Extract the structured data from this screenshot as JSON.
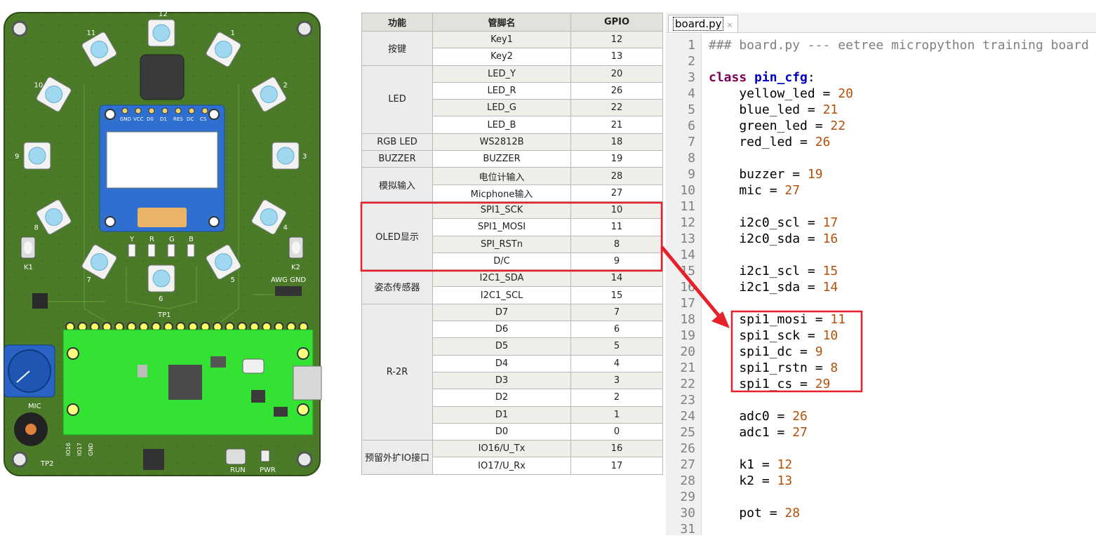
{
  "board": {
    "led_numbers": [
      "12",
      "1",
      "2",
      "3",
      "4",
      "5",
      "6",
      "7",
      "8",
      "9",
      "10",
      "11"
    ],
    "oled_pins": [
      "GND",
      "VCC",
      "D0",
      "D1",
      "RES",
      "DC",
      "CS"
    ],
    "led_row_labels": [
      "Y",
      "R",
      "G",
      "B"
    ],
    "k1_label": "K1",
    "k2_label": "K2",
    "awg_label": "AWG GND",
    "tp1_label": "TP1",
    "tp2_label": "TP2",
    "mic_label": "MIC",
    "run_label": "RUN",
    "pwr_label": "PWR",
    "pico_pins": [
      "IO16",
      "IO17",
      "GND"
    ],
    "colors": {
      "pcb": "#4a7a28",
      "pico": "#34e234",
      "oled_blue": "#2e6fd0",
      "led_cyan": "#9fd8f0"
    }
  },
  "table": {
    "headers": [
      "功能",
      "管脚名",
      "GPIO"
    ],
    "groups": [
      {
        "name": "按键",
        "rows": [
          [
            "Key1",
            "12"
          ],
          [
            "Key2",
            "13"
          ]
        ]
      },
      {
        "name": "LED",
        "rows": [
          [
            "LED_Y",
            "20"
          ],
          [
            "LED_R",
            "26"
          ],
          [
            "LED_G",
            "22"
          ],
          [
            "LED_B",
            "21"
          ]
        ]
      },
      {
        "name": "RGB LED",
        "rows": [
          [
            "WS2812B",
            "18"
          ]
        ]
      },
      {
        "name": "BUZZER",
        "rows": [
          [
            "BUZZER",
            "19"
          ]
        ]
      },
      {
        "name": "模拟输入",
        "rows": [
          [
            "电位计输入",
            "28"
          ],
          [
            "Micphone输入",
            "27"
          ]
        ]
      },
      {
        "name": "OLED显示",
        "rows": [
          [
            "SPI1_SCK",
            "10"
          ],
          [
            "SPI1_MOSI",
            "11"
          ],
          [
            "SPI_RSTn",
            "8"
          ],
          [
            "D/C",
            "9"
          ]
        ]
      },
      {
        "name": "姿态传感器",
        "rows": [
          [
            "I2C1_SDA",
            "14"
          ],
          [
            "I2C1_SCL",
            "15"
          ]
        ]
      },
      {
        "name": "R-2R",
        "rows": [
          [
            "D7",
            "7"
          ],
          [
            "D6",
            "6"
          ],
          [
            "D5",
            "5"
          ],
          [
            "D4",
            "4"
          ],
          [
            "D3",
            "3"
          ],
          [
            "D2",
            "2"
          ],
          [
            "D1",
            "1"
          ],
          [
            "D0",
            "0"
          ]
        ]
      },
      {
        "name": "预留外扩IO接口",
        "rows": [
          [
            "IO16/U_Tx",
            "16"
          ],
          [
            "IO17/U_Rx",
            "17"
          ]
        ]
      }
    ]
  },
  "editor": {
    "tab_label": "board.py",
    "tab_close": "×",
    "lines": [
      "### board.py --- eetree micropython training board",
      "",
      "class pin_cfg:",
      "    yellow_led = 20",
      "    blue_led = 21",
      "    green_led = 22",
      "    red_led = 26",
      "",
      "    buzzer = 19",
      "    mic = 27",
      "",
      "    i2c0_scl = 17",
      "    i2c0_sda = 16",
      "",
      "    i2c1_scl = 15",
      "    i2c1_sda = 14",
      "",
      "    spi1_mosi = 11",
      "    spi1_sck = 10",
      "    spi1_dc = 9",
      "    spi1_rstn = 8",
      "    spi1_cs = 29",
      "",
      "    adc0 = 26",
      "    adc1 = 27",
      "",
      "    k1 = 12",
      "    k2 = 13",
      "",
      "    pot = 28",
      ""
    ],
    "colors": {
      "keyword": "#7f0055",
      "classname": "#0000c0",
      "number": "#b4500a",
      "comment": "#808080"
    }
  },
  "highlight": {
    "color": "#e8202a"
  }
}
